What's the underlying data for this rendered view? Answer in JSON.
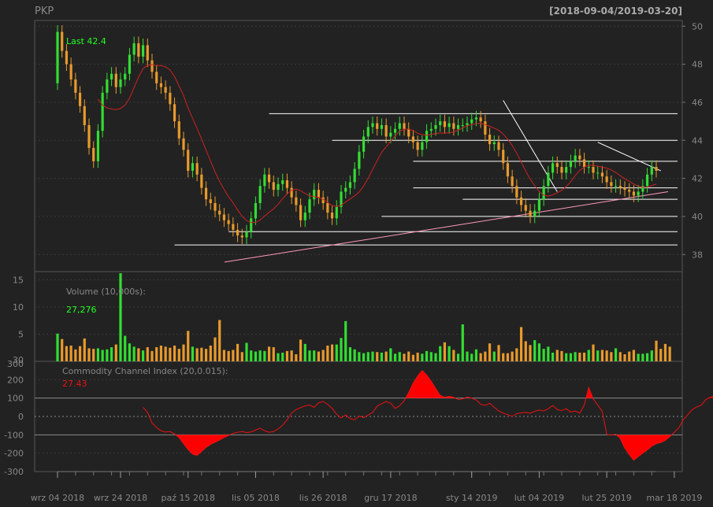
{
  "symbol": "PKP",
  "date_range": "[2018-09-04/2019-03-20]",
  "last_label": "Last 42.4",
  "volume_label": "Volume (10,000s):",
  "volume_value": "27,276",
  "cci_label": "Commodity Channel Index (20,0.015):",
  "cci_value": "27.43",
  "colors": {
    "background": "#222222",
    "panel_border": "#555555",
    "grid": "#3a3a3a",
    "text": "#888888",
    "up": "#33dd33",
    "down": "#e89a2c",
    "last_text": "#22ff22",
    "sma": "#cc2222",
    "cci_line": "#ee1111",
    "cci_fill": "#ff0000",
    "trend_line": "#ff99bb",
    "level_line": "#ffffff"
  },
  "chart_data": {
    "type": "candlestick",
    "x_tick_labels": [
      "wrz 04 2018",
      "wrz 24 2018",
      "paź 15 2018",
      "lis 05 2018",
      "lis 26 2018",
      "gru 17 2018",
      "sty 14 2019",
      "lut 04 2019",
      "lut 25 2019",
      "mar 18 2019"
    ],
    "x_tick_indices": [
      0,
      14,
      29,
      44,
      59,
      74,
      92,
      107,
      122,
      137
    ],
    "price_axis": {
      "ticks": [
        38,
        40,
        42,
        44,
        46,
        48,
        50
      ],
      "ylim": [
        37.1,
        50.3
      ]
    },
    "volume_axis": {
      "ticks": [
        5,
        10,
        15,
        30
      ],
      "ylim": [
        0,
        16.5
      ]
    },
    "cci_axis": {
      "ticks": [
        -300,
        -200,
        -100,
        0,
        100,
        200,
        300
      ],
      "ylim": [
        -300,
        300
      ],
      "reference_lines": [
        -100,
        0,
        100
      ]
    },
    "close": [
      49.7,
      48.7,
      48.0,
      47.2,
      46.5,
      45.8,
      44.8,
      43.6,
      42.9,
      44.5,
      46.5,
      47.2,
      47.5,
      46.8,
      47.2,
      47.5,
      48.5,
      49.1,
      48.4,
      49.0,
      48.2,
      47.6,
      47.0,
      46.8,
      46.5,
      45.9,
      45.0,
      44.1,
      43.5,
      42.4,
      42.8,
      42.2,
      41.5,
      40.9,
      40.7,
      40.3,
      40.1,
      39.8,
      39.6,
      39.3,
      39.0,
      38.9,
      39.2,
      39.9,
      40.7,
      41.6,
      42.2,
      41.8,
      41.4,
      41.7,
      41.9,
      41.5,
      41.0,
      40.6,
      39.8,
      40.2,
      40.9,
      41.4,
      41.0,
      40.7,
      40.2,
      39.9,
      40.5,
      41.3,
      41.5,
      41.8,
      42.5,
      43.4,
      44.2,
      44.7,
      44.9,
      44.6,
      44.8,
      44.2,
      44.4,
      44.6,
      44.9,
      44.6,
      44.2,
      43.9,
      43.5,
      43.9,
      44.5,
      44.6,
      44.8,
      45.0,
      44.7,
      44.9,
      44.6,
      44.8,
      44.8,
      44.9,
      45.1,
      45.2,
      45.0,
      44.3,
      43.8,
      43.9,
      43.5,
      42.8,
      42.1,
      41.6,
      41.0,
      40.6,
      40.3,
      40.0,
      40.3,
      40.9,
      41.6,
      42.3,
      42.8,
      42.6,
      42.3,
      42.6,
      42.9,
      43.2,
      43.0,
      42.6,
      42.6,
      42.3,
      42.3,
      42.1,
      41.8,
      41.6,
      41.6,
      41.5,
      41.4,
      41.3,
      41.1,
      41.3,
      41.6,
      42.2,
      42.6,
      42.4
    ],
    "volume": [
      5.1,
      4.1,
      2.8,
      2.9,
      2.2,
      2.8,
      4.2,
      2.4,
      2.3,
      2.4,
      2.1,
      2.2,
      2.6,
      3.1,
      16.2,
      4.7,
      3.3,
      2.7,
      2.4,
      2.0,
      2.6,
      1.9,
      2.6,
      2.9,
      2.7,
      2.5,
      2.9,
      2.3,
      3.1,
      5.6,
      2.7,
      2.4,
      2.5,
      2.3,
      2.9,
      4.4,
      7.6,
      2.1,
      1.9,
      2.1,
      3.2,
      1.7,
      3.4,
      2.0,
      1.8,
      2.0,
      1.9,
      2.7,
      2.6,
      1.5,
      1.6,
      1.9,
      2.0,
      1.3,
      4.0,
      3.2,
      2.0,
      2.0,
      1.8,
      2.1,
      2.9,
      3.1,
      3.1,
      4.3,
      7.4,
      2.6,
      2.2,
      1.7,
      1.5,
      1.7,
      1.8,
      1.7,
      1.6,
      1.8,
      2.4,
      1.4,
      1.7,
      1.4,
      1.8,
      1.2,
      1.6,
      1.4,
      1.9,
      1.7,
      1.5,
      2.8,
      3.5,
      2.8,
      2.1,
      1.4,
      6.8,
      1.8,
      1.4,
      2.2,
      1.5,
      1.8,
      3.3,
      1.8,
      3.0,
      1.5,
      1.5,
      1.8,
      2.4,
      6.3,
      3.7,
      3.0,
      3.9,
      3.3,
      2.3,
      2.7,
      1.6,
      2.1,
      1.9,
      1.5,
      1.5,
      1.7,
      1.6,
      1.6,
      2.1,
      3.1,
      2.0,
      2.1,
      2.0,
      1.7,
      2.4,
      1.7,
      1.3,
      1.8,
      2.1,
      1.4,
      1.4,
      1.5,
      2.0,
      3.8,
      2.3,
      3.2,
      2.7
    ],
    "cci": [
      null,
      null,
      null,
      null,
      null,
      null,
      null,
      null,
      null,
      null,
      null,
      null,
      null,
      null,
      null,
      null,
      null,
      null,
      null,
      50,
      22,
      -35,
      -60,
      -78,
      -85,
      -82,
      -95,
      -115,
      -148,
      -180,
      -205,
      -212,
      -190,
      -168,
      -152,
      -140,
      -128,
      -115,
      -103,
      -92,
      -86,
      -82,
      -88,
      -84,
      -74,
      -64,
      -78,
      -86,
      -82,
      -68,
      -48,
      -18,
      18,
      38,
      48,
      58,
      62,
      50,
      74,
      82,
      66,
      44,
      12,
      -8,
      8,
      -12,
      -18,
      2,
      -6,
      8,
      22,
      56,
      70,
      82,
      72,
      44,
      58,
      86,
      130,
      182,
      220,
      250,
      226,
      192,
      152,
      115,
      104,
      110,
      104,
      92,
      96,
      105,
      100,
      90,
      66,
      60,
      72,
      50,
      30,
      18,
      10,
      0,
      15,
      20,
      22,
      18,
      28,
      35,
      30,
      42,
      60,
      38,
      32,
      42,
      24,
      30,
      18,
      62,
      158,
      95,
      62,
      28,
      -98,
      -102,
      -96,
      -120,
      -172,
      -208,
      -238,
      -218,
      -200,
      -182,
      -162,
      -148,
      -142,
      -130,
      -110,
      -86,
      -62,
      -18,
      10,
      38,
      52,
      62,
      92,
      105,
      110,
      96,
      90,
      80,
      72,
      60,
      50,
      40,
      35,
      28
    ]
  },
  "annotations": {
    "level_lines": [
      45.4,
      44.0,
      42.9,
      41.5,
      40.9,
      40.0,
      39.2,
      38.5
    ],
    "trend_line": [
      [
        38.0,
        37.6
      ],
      [
        41.3,
        41.3
      ]
    ],
    "wedge_upper": [
      [
        99,
        46.1
      ],
      [
        111,
        41.3
      ]
    ],
    "wedge_lower": [
      [
        120,
        43.9
      ],
      [
        134,
        42.4
      ]
    ]
  }
}
